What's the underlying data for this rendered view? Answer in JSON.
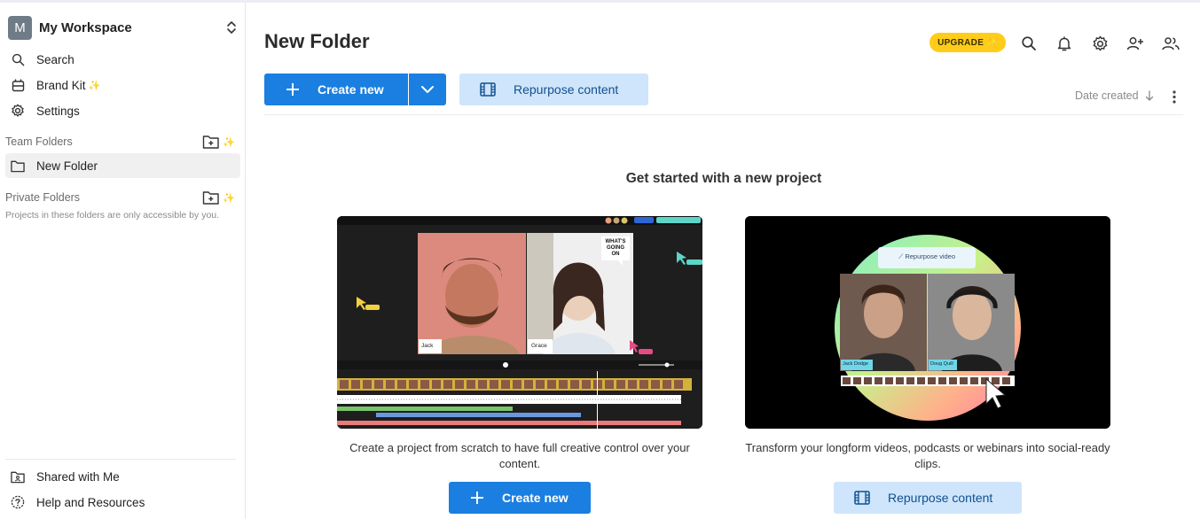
{
  "workspace": {
    "avatar_letter": "M",
    "name": "My Workspace"
  },
  "sidebar": {
    "search": "Search",
    "brand_kit": "Brand Kit",
    "settings": "Settings",
    "team_folders_title": "Team Folders",
    "team_folder_item": "New Folder",
    "private_folders_title": "Private Folders",
    "private_note": "Projects in these folders are only accessible by you.",
    "shared": "Shared with Me",
    "help": "Help and Resources",
    "sparkle": "✨"
  },
  "header": {
    "title": "New Folder",
    "upgrade": "UPGRADE",
    "upgrade_sparkle": "✨"
  },
  "toolbar": {
    "create_new": "Create new",
    "repurpose": "Repurpose content",
    "sort_label": "Date created"
  },
  "empty_state": {
    "heading": "Get started with a new project",
    "card_left": {
      "description": "Create a project from scratch to have full creative control over your content.",
      "button": "Create new",
      "preview": {
        "bubble": [
          "WHAT'S",
          "GOING",
          "ON"
        ],
        "name_left": "Jack",
        "name_right": "Grace"
      }
    },
    "card_right": {
      "description": "Transform your longform videos, podcasts or webinars into social-ready clips.",
      "button": "Repurpose content",
      "preview": {
        "pill": "Repurpose video",
        "name_left": "Jack Dodge",
        "name_right": "Doug Quill"
      }
    }
  },
  "colors": {
    "primary": "#1a7fe0",
    "secondary_bg": "#cfe5fb",
    "upgrade": "#ffcc1a"
  }
}
